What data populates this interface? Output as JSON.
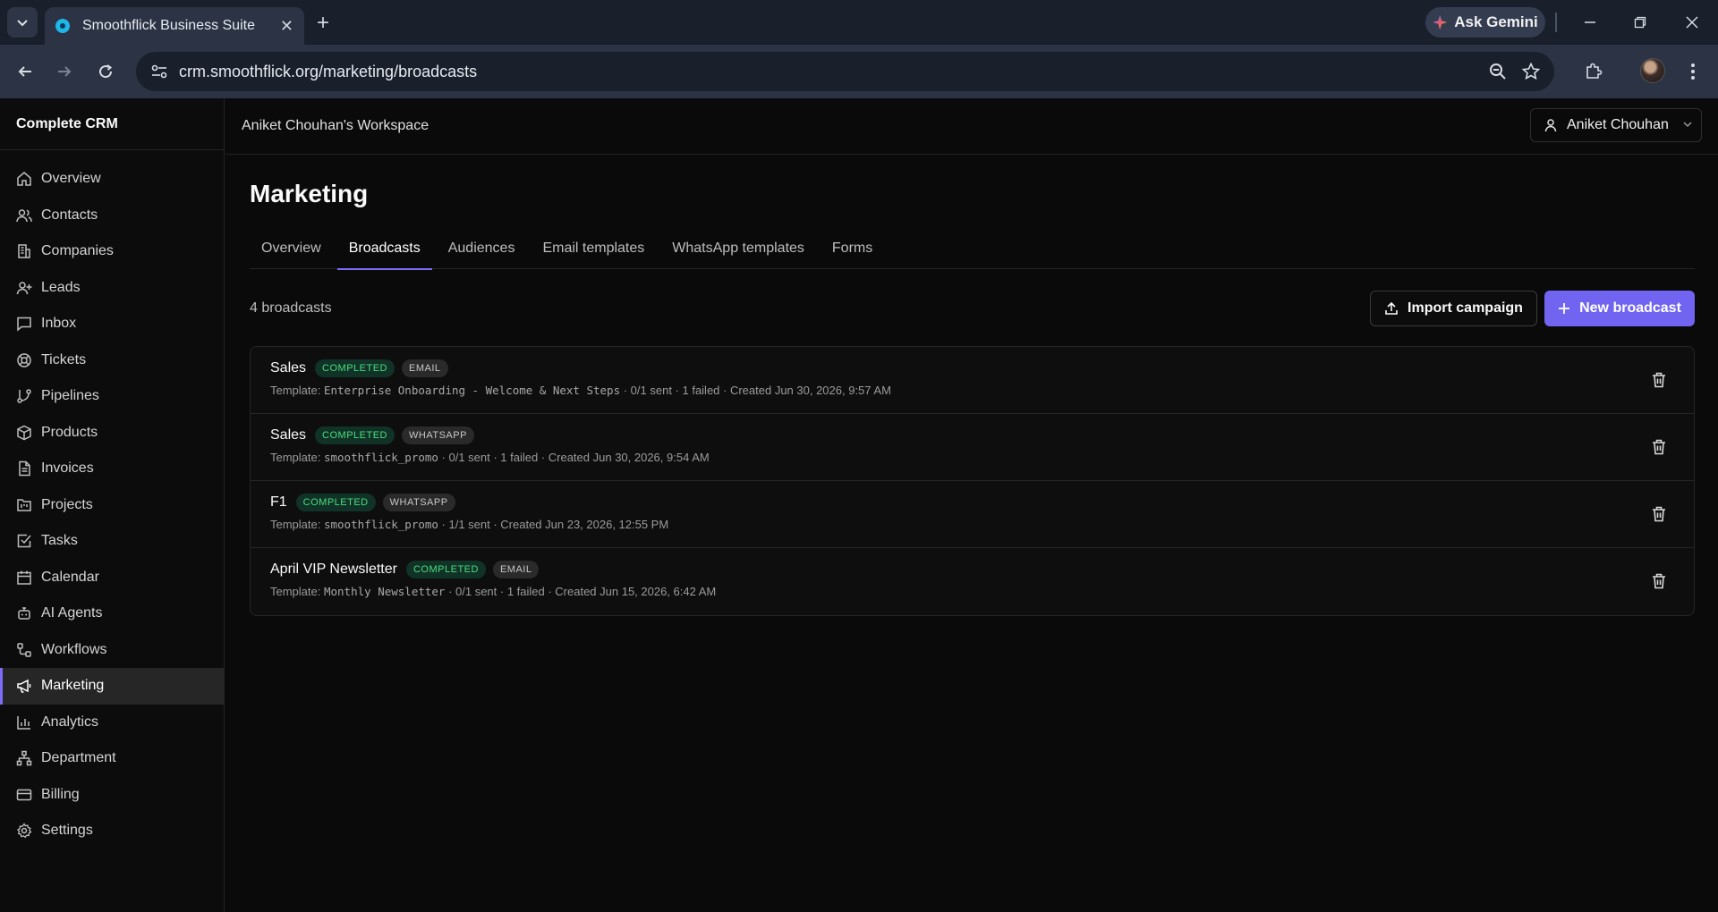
{
  "browser": {
    "tab_title": "Smoothflick Business Suite",
    "url": "crm.smoothflick.org/marketing/broadcasts",
    "gemini_label": "Ask Gemini"
  },
  "sidebar": {
    "brand": "Complete CRM",
    "items": [
      {
        "label": "Overview",
        "icon": "home-icon"
      },
      {
        "label": "Contacts",
        "icon": "users-icon"
      },
      {
        "label": "Companies",
        "icon": "building-icon"
      },
      {
        "label": "Leads",
        "icon": "user-plus-icon"
      },
      {
        "label": "Inbox",
        "icon": "message-icon"
      },
      {
        "label": "Tickets",
        "icon": "lifebuoy-icon"
      },
      {
        "label": "Pipelines",
        "icon": "git-branch-icon"
      },
      {
        "label": "Products",
        "icon": "package-icon"
      },
      {
        "label": "Invoices",
        "icon": "file-text-icon"
      },
      {
        "label": "Projects",
        "icon": "folder-kanban-icon"
      },
      {
        "label": "Tasks",
        "icon": "check-square-icon"
      },
      {
        "label": "Calendar",
        "icon": "calendar-icon"
      },
      {
        "label": "AI Agents",
        "icon": "bot-icon"
      },
      {
        "label": "Workflows",
        "icon": "workflow-icon"
      },
      {
        "label": "Marketing",
        "icon": "megaphone-icon",
        "active": true
      },
      {
        "label": "Analytics",
        "icon": "bar-chart-icon"
      },
      {
        "label": "Department",
        "icon": "network-icon"
      },
      {
        "label": "Billing",
        "icon": "credit-card-icon"
      },
      {
        "label": "Settings",
        "icon": "gear-icon"
      }
    ]
  },
  "header": {
    "workspace": "Aniket Chouhan's Workspace",
    "user_name": "Aniket Chouhan"
  },
  "main": {
    "title": "Marketing",
    "tabs": [
      "Overview",
      "Broadcasts",
      "Audiences",
      "Email templates",
      "WhatsApp templates",
      "Forms"
    ],
    "active_tab": "Broadcasts",
    "count_label": "4 broadcasts",
    "import_label": "Import campaign",
    "new_label": "New broadcast",
    "broadcasts": [
      {
        "name": "Sales",
        "status": "COMPLETED",
        "channel": "EMAIL",
        "template_prefix": "Template: ",
        "template": "Enterprise Onboarding - Welcome & Next Steps",
        "meta": " · 0/1 sent · 1 failed · Created Jun 30, 2026, 9:57 AM"
      },
      {
        "name": "Sales",
        "status": "COMPLETED",
        "channel": "WHATSAPP",
        "template_prefix": "Template: ",
        "template": "smoothflick_promo",
        "meta": " · 0/1 sent · 1 failed · Created Jun 30, 2026, 9:54 AM"
      },
      {
        "name": "F1",
        "status": "COMPLETED",
        "channel": "WHATSAPP",
        "template_prefix": "Template: ",
        "template": "smoothflick_promo",
        "meta": " · 1/1 sent · Created Jun 23, 2026, 12:55 PM"
      },
      {
        "name": "April VIP Newsletter",
        "status": "COMPLETED",
        "channel": "EMAIL",
        "template_prefix": "Template: ",
        "template": "Monthly Newsletter",
        "meta": " · 0/1 sent · 1 failed · Created Jun 15, 2026, 6:42 AM"
      }
    ]
  },
  "colors": {
    "accent": "#7164f0",
    "completed_text": "#4ade80",
    "completed_bg": "#113226"
  }
}
